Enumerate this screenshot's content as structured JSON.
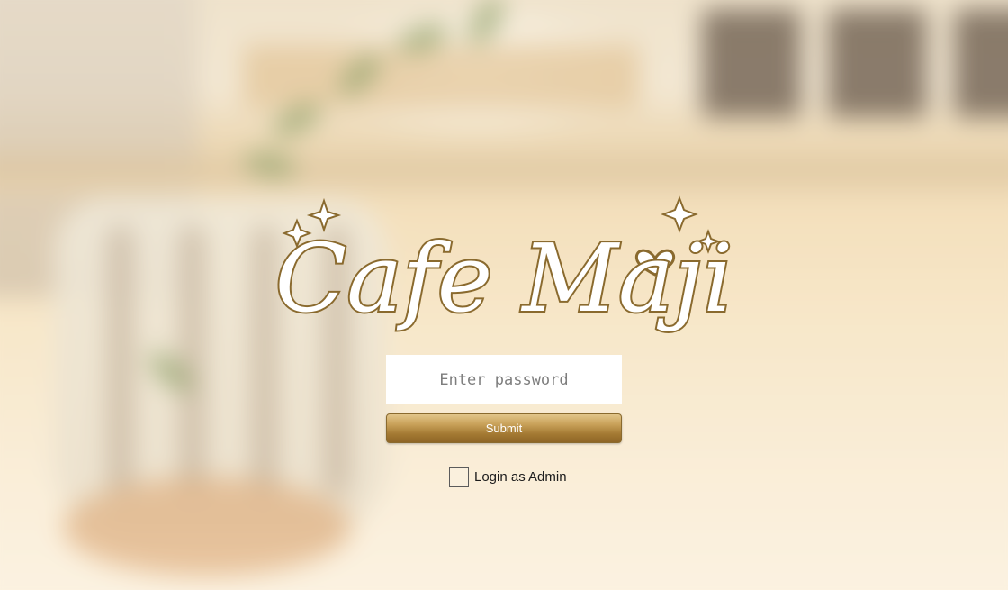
{
  "app": {
    "logo_text": "Cafe Maji"
  },
  "login": {
    "password_placeholder": "Enter password",
    "password_value": "",
    "submit_label": "Submit",
    "admin_checkbox_label": "Login as Admin",
    "admin_checked": false
  },
  "colors": {
    "logo_fill": "#ffffff",
    "logo_outline": "#8a6a2e",
    "button_gold": "#a47a33"
  }
}
